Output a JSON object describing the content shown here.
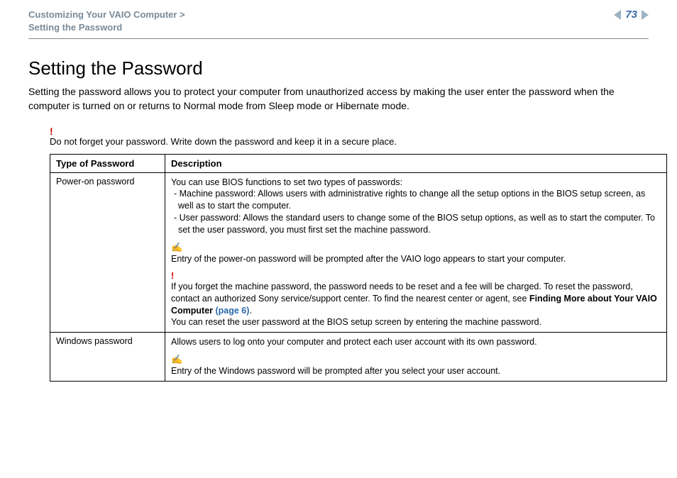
{
  "header": {
    "breadcrumb_line1": "Customizing Your VAIO Computer >",
    "breadcrumb_line2": "Setting the Password",
    "page_number": "73"
  },
  "title": "Setting the Password",
  "intro": "Setting the password allows you to protect your computer from unauthorized access by making the user enter the password when the computer is turned on or returns to Normal mode from Sleep mode or Hibernate mode.",
  "top_warning": "Do not forget your password. Write down the password and keep it in a secure place.",
  "table": {
    "headers": {
      "col1": "Type of Password",
      "col2": "Description"
    },
    "rows": [
      {
        "type": "Power-on password",
        "desc_intro": "You can use BIOS functions to set two types of passwords:",
        "bullet1": "- Machine password: Allows users with administrative rights to change all the setup options in the BIOS setup screen, as well as to start the computer.",
        "bullet2": "- User password: Allows the standard users to change some of the BIOS setup options, as well as to start the computer. To set the user password, you must first set the machine password.",
        "note_icon": "✍",
        "note1": "Entry of the power-on password will be prompted after the VAIO logo appears to start your computer.",
        "warn_icon": "!",
        "warn_text_a": "If you forget the machine password, the password needs to be reset and a fee will be charged. To reset the password, contact an authorized Sony service/support center. To find the nearest center or agent, see ",
        "warn_link_label": "Finding More about Your VAIO Computer ",
        "warn_link_page": "(page 6)",
        "warn_text_b": ".",
        "warn_tail": "You can reset the user password at the BIOS setup screen by entering the machine password."
      },
      {
        "type": "Windows password",
        "desc_intro": "Allows users to log onto your computer and protect each user account with its own password.",
        "note_icon": "✍",
        "note1": "Entry of the Windows password will be prompted after you select your user account."
      }
    ]
  }
}
